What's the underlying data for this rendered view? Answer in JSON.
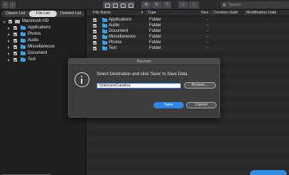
{
  "toolbar": {
    "search_placeholder": "Search",
    "help_label": "?"
  },
  "sidebar": {
    "tabs": [
      "Classic List",
      "File List",
      "Deleted List"
    ],
    "active_tab": "File List",
    "tree": [
      {
        "label": "Macintosh HD",
        "kind": "drive",
        "expanded": true
      },
      {
        "label": "Applications",
        "kind": "folder"
      },
      {
        "label": "Photos",
        "kind": "folder"
      },
      {
        "label": "Audio",
        "kind": "folder"
      },
      {
        "label": "Miscellaneous",
        "kind": "folder"
      },
      {
        "label": "Document",
        "kind": "folder"
      },
      {
        "label": "Text",
        "kind": "folder"
      }
    ]
  },
  "file_list": {
    "columns": [
      "File Name",
      "Type",
      "Size",
      "Creation Date",
      "Modification Date"
    ],
    "rows": [
      {
        "name": "Applications",
        "type": "Folder",
        "size": "--"
      },
      {
        "name": "Audio",
        "type": "Folder",
        "size": "--"
      },
      {
        "name": "Document",
        "type": "Folder",
        "size": "--"
      },
      {
        "name": "Miscellaneous",
        "type": "Folder",
        "size": "--"
      },
      {
        "name": "Photos",
        "type": "Folder",
        "size": "--"
      },
      {
        "name": "Text",
        "type": "Folder",
        "size": "--"
      }
    ]
  },
  "dialog": {
    "title": "Recover",
    "message": "Select Destination and click 'Save' to Save Data.",
    "path_value": "/Volumes/Catalina",
    "browse_label": "Browse...",
    "save_label": "Save",
    "cancel_label": "Cancel"
  },
  "colors": {
    "accent": "#2e86e6",
    "folder": "#3b9fe6",
    "background": "#1e1e1f"
  }
}
